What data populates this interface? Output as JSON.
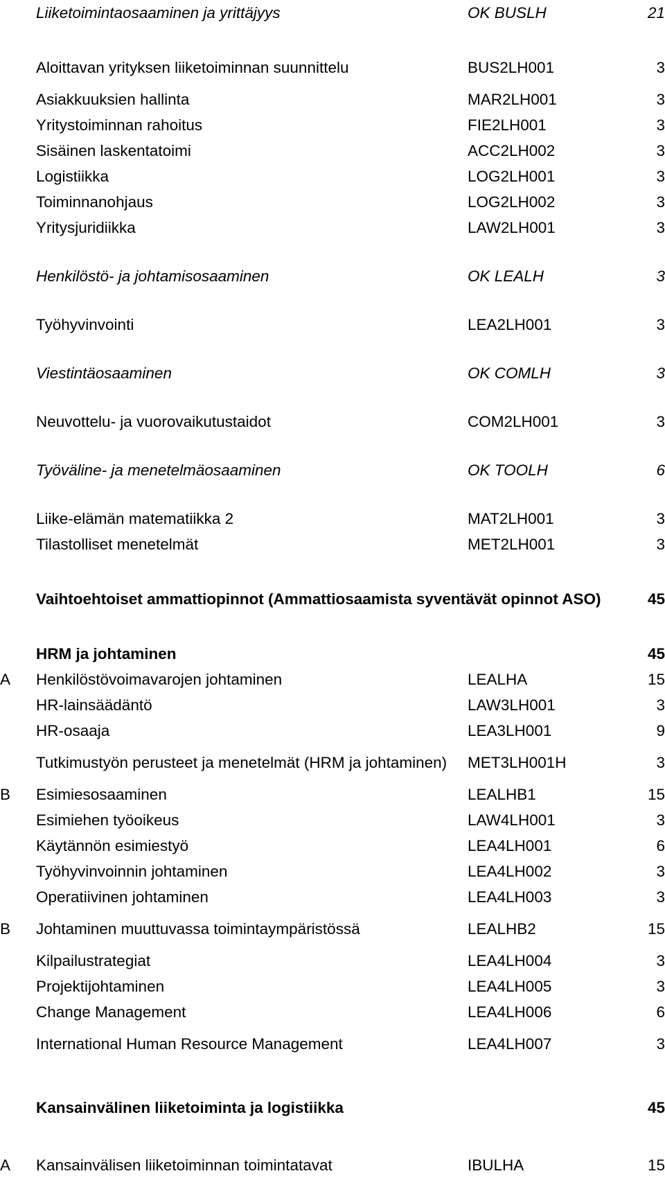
{
  "document": {
    "type": "curriculum-structure-table",
    "language": "fi"
  },
  "columns": {
    "letter": "",
    "name": "",
    "code": "",
    "credits": ""
  },
  "rows": [
    {
      "letter": "",
      "name": "Liiketoimintaosaaminen ja yrittäjyys",
      "code": "OK BUSLH",
      "credits": "21",
      "style": "italic",
      "indent": "head"
    },
    {
      "letter": "",
      "name": "Aloittavan yrityksen liiketoiminnan suunnittelu",
      "code": "BUS2LH001",
      "credits": "3",
      "style": "normal",
      "indent": "sub"
    },
    {
      "letter": "",
      "name": "Asiakkuuksien hallinta",
      "code": "MAR2LH001",
      "credits": "3",
      "style": "normal",
      "indent": "sub"
    },
    {
      "letter": "",
      "name": "Yritystoiminnan rahoitus",
      "code": "FIE2LH001",
      "credits": "3",
      "style": "normal",
      "indent": "sub"
    },
    {
      "letter": "",
      "name": "Sisäinen laskentatoimi",
      "code": "ACC2LH002",
      "credits": "3",
      "style": "normal",
      "indent": "sub"
    },
    {
      "letter": "",
      "name": "Logistiikka",
      "code": "LOG2LH001",
      "credits": "3",
      "style": "normal",
      "indent": "sub"
    },
    {
      "letter": "",
      "name": "Toiminnanohjaus",
      "code": "LOG2LH002",
      "credits": "3",
      "style": "normal",
      "indent": "sub"
    },
    {
      "letter": "",
      "name": "Yritysjuridiikka",
      "code": "LAW2LH001",
      "credits": "3",
      "style": "normal",
      "indent": "sub"
    },
    {
      "letter": "",
      "name": "Henkilöstö- ja johtamisosaaminen",
      "code": "OK LEALH",
      "credits": "3",
      "style": "italic",
      "indent": "head"
    },
    {
      "letter": "",
      "name": "Työhyvinvointi",
      "code": "LEA2LH001",
      "credits": "3",
      "style": "normal",
      "indent": "sub"
    },
    {
      "letter": "",
      "name": "Viestintäosaaminen",
      "code": "OK COMLH",
      "credits": "3",
      "style": "italic",
      "indent": "head"
    },
    {
      "letter": "",
      "name": "Neuvottelu- ja vuorovaikutustaidot",
      "code": "COM2LH001",
      "credits": "3",
      "style": "normal",
      "indent": "sub"
    },
    {
      "letter": "",
      "name": "Työväline- ja menetelmäosaaminen",
      "code": "OK TOOLH",
      "credits": "6",
      "style": "italic",
      "indent": "head"
    },
    {
      "letter": "",
      "name": "Liike-elämän matematiikka 2",
      "code": "MAT2LH001",
      "credits": "3",
      "style": "normal",
      "indent": "sub"
    },
    {
      "letter": "",
      "name": "Tilastolliset menetelmät",
      "code": "MET2LH001",
      "credits": "3",
      "style": "normal",
      "indent": "sub"
    },
    {
      "letter": "",
      "name": "Vaihtoehtoiset ammattiopinnot (Ammattiosaamista syventävät opinnot ASO)",
      "code": "",
      "credits": "45",
      "style": "bold",
      "indent": "top"
    },
    {
      "letter": "",
      "name": "HRM ja johtaminen",
      "code": "",
      "credits": "45",
      "style": "bold",
      "indent": "head"
    },
    {
      "letter": "A",
      "name": "Henkilöstövoimavarojen johtaminen",
      "code": "LEALHA",
      "credits": "15",
      "style": "normal",
      "indent": "sub"
    },
    {
      "letter": "",
      "name": "HR-lainsäädäntö",
      "code": "LAW3LH001",
      "credits": "3",
      "style": "normal",
      "indent": "sub"
    },
    {
      "letter": "",
      "name": "HR-osaaja",
      "code": "LEA3LH001",
      "credits": "9",
      "style": "normal",
      "indent": "sub"
    },
    {
      "letter": "",
      "name": "Tutkimustyön perusteet ja menetelmät (HRM ja johtaminen)",
      "code": "MET3LH001H",
      "credits": "3",
      "style": "normal",
      "indent": "sub"
    },
    {
      "letter": "B",
      "name": "Esimiesosaaminen",
      "code": "LEALHB1",
      "credits": "15",
      "style": "normal",
      "indent": "sub"
    },
    {
      "letter": "",
      "name": "Esimiehen työoikeus",
      "code": "LAW4LH001",
      "credits": "3",
      "style": "normal",
      "indent": "sub"
    },
    {
      "letter": "",
      "name": "Käytännön esimiestyö",
      "code": "LEA4LH001",
      "credits": "6",
      "style": "normal",
      "indent": "sub"
    },
    {
      "letter": "",
      "name": "Työhyvinvoinnin johtaminen",
      "code": "LEA4LH002",
      "credits": "3",
      "style": "normal",
      "indent": "sub"
    },
    {
      "letter": "",
      "name": "Operatiivinen johtaminen",
      "code": "LEA4LH003",
      "credits": "3",
      "style": "normal",
      "indent": "sub"
    },
    {
      "letter": "B",
      "name": "Johtaminen muuttuvassa toimintaympäristössä",
      "code": "LEALHB2",
      "credits": "15",
      "style": "normal",
      "indent": "sub"
    },
    {
      "letter": "",
      "name": "Kilpailustrategiat",
      "code": "LEA4LH004",
      "credits": "3",
      "style": "normal",
      "indent": "sub"
    },
    {
      "letter": "",
      "name": "Projektijohtaminen",
      "code": "LEA4LH005",
      "credits": "3",
      "style": "normal",
      "indent": "sub"
    },
    {
      "letter": "",
      "name": "Change Management",
      "code": "LEA4LH006",
      "credits": "6",
      "style": "normal",
      "indent": "sub"
    },
    {
      "letter": "",
      "name": "International Human Resource Management",
      "code": "LEA4LH007",
      "credits": "3",
      "style": "normal",
      "indent": "sub"
    },
    {
      "letter": "",
      "name": "Kansainvälinen liiketoiminta ja logistiikka",
      "code": "",
      "credits": "45",
      "style": "bold",
      "indent": "head"
    },
    {
      "letter": "A",
      "name": "Kansainvälisen liiketoiminnan toimintatavat",
      "code": "IBULHA",
      "credits": "15",
      "style": "normal",
      "indent": "sub"
    }
  ]
}
